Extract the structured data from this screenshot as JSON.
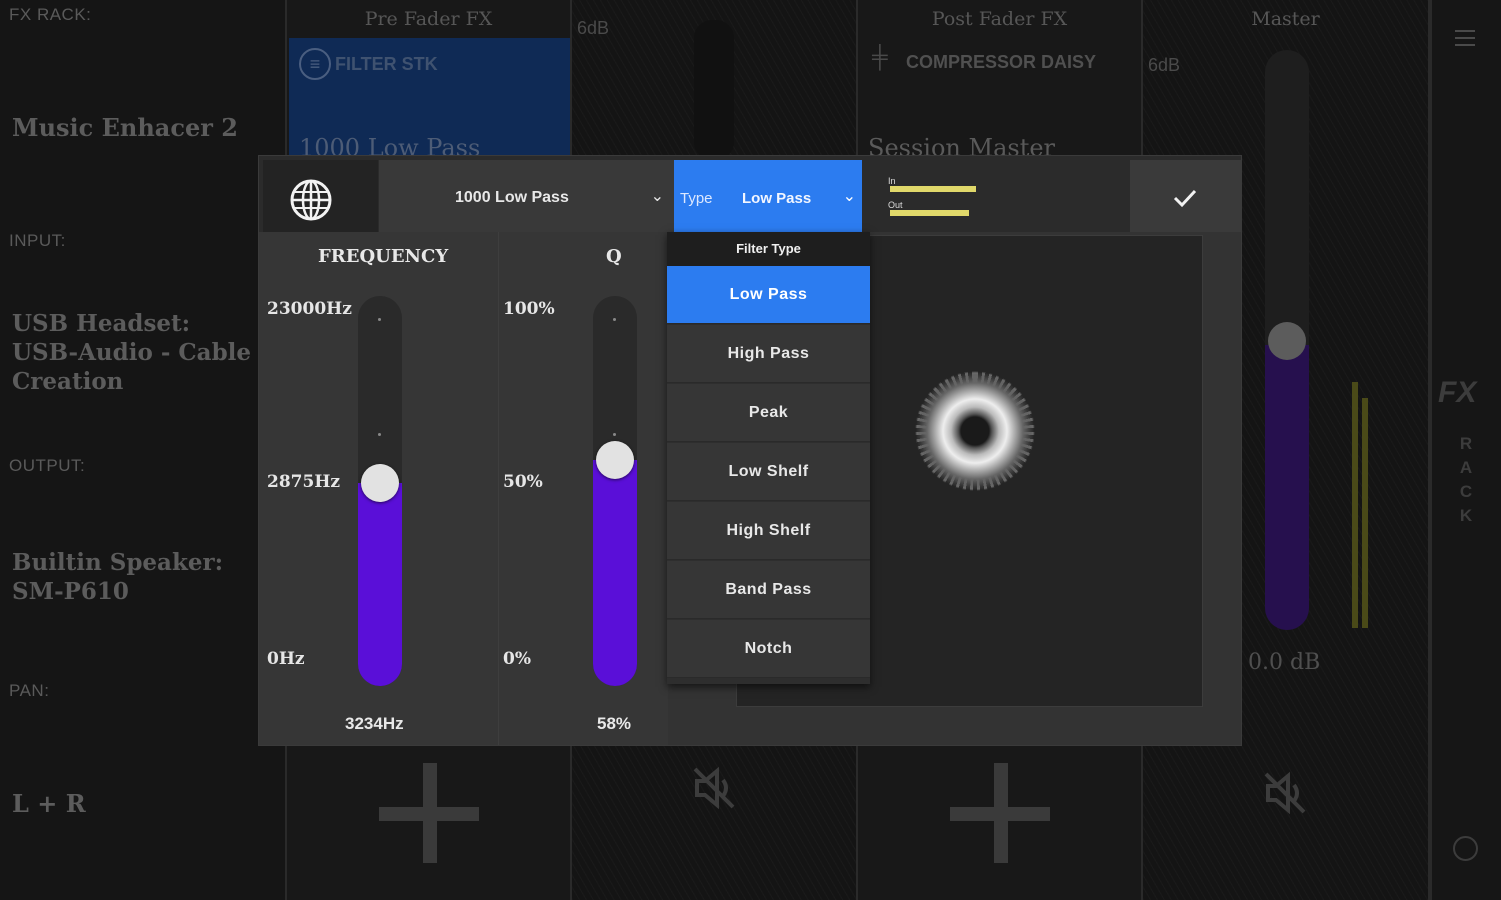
{
  "mixer": {
    "left": {
      "fx_rack_label": "FX RACK:",
      "fx_rack_value": "Music Enhacer 2",
      "input_label": "INPUT:",
      "input_value_1": "USB Headset:",
      "input_value_2": "USB-Audio - Cable",
      "input_value_3": "Creation",
      "output_label": "OUTPUT:",
      "output_value_1": "Builtin Speaker:",
      "output_value_2": "SM-P610",
      "pan_label": "PAN:",
      "pan_value": "L + R"
    },
    "pre_fader": {
      "title": "Pre Fader FX",
      "effect": "FILTER STK",
      "preset": "1000 Low Pass"
    },
    "channel": {
      "db_label": "6dB"
    },
    "post_fader": {
      "title": "Post Fader FX",
      "effect": "COMPRESSOR DAISY",
      "preset": "Session Master"
    },
    "master": {
      "title": "Master",
      "db_label": "6dB",
      "value": "0.0 dB"
    },
    "side": {
      "fx": "FX",
      "rack": [
        "R",
        "A",
        "C",
        "K"
      ]
    }
  },
  "dialog": {
    "preset": "1000 Low Pass",
    "type_prefix": "Type",
    "type_value": "Low Pass",
    "meters": {
      "in_label": "In",
      "out_label": "Out",
      "in_level": 0.9,
      "out_level": 0.82
    },
    "frequency": {
      "title": "FREQUENCY",
      "max": "23000Hz",
      "mid": "2875Hz",
      "min": "0Hz",
      "value": "3234Hz",
      "level": 0.52
    },
    "q": {
      "title": "Q",
      "max": "100%",
      "mid": "50%",
      "min": "0%",
      "value": "58%",
      "level": 0.58
    },
    "filter_menu": {
      "header": "Filter Type",
      "items": [
        "Low Pass",
        "High Pass",
        "Peak",
        "Low Shelf",
        "High Shelf",
        "Band Pass",
        "Notch"
      ],
      "selected_index": 0
    }
  },
  "colors": {
    "accent": "#2c7cf0",
    "slider_fill": "#5a0fd8",
    "meter": "#e0d86a"
  }
}
